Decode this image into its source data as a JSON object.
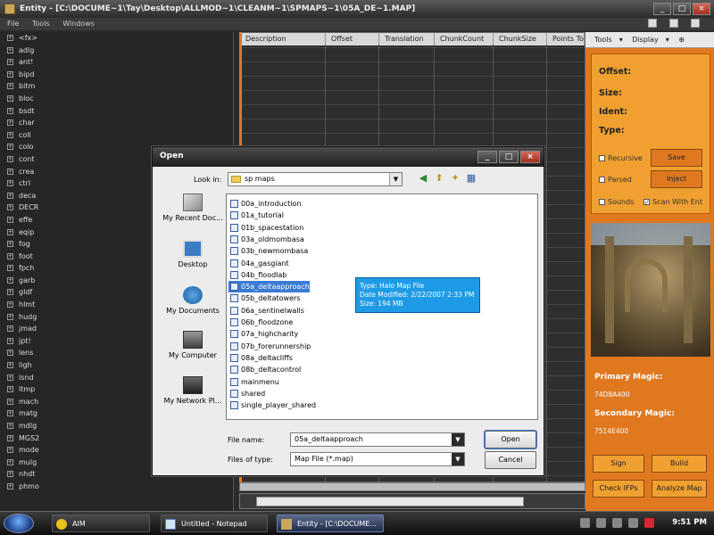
{
  "app": {
    "title": "Entity - [C:\\DOCUME~1\\Tay\\Desktop\\ALLMOD~1\\CLEANM~1\\SPMAPS~1\\05A_DE~1.MAP]",
    "menu": [
      "File",
      "Tools",
      "Windows"
    ]
  },
  "tags": [
    "<fx>",
    "adlg",
    "ant!",
    "bipd",
    "bitm",
    "bloc",
    "bsdt",
    "char",
    "coll",
    "colo",
    "cont",
    "crea",
    "ctrl",
    "deca",
    "DECR",
    "effe",
    "eqip",
    "fog",
    "foot",
    "fpch",
    "garb",
    "gldf",
    "hlmt",
    "hudg",
    "jmad",
    "jpt!",
    "lens",
    "ligh",
    "lsnd",
    "ltmp",
    "mach",
    "matg",
    "mdlg",
    "MGS2",
    "mode",
    "mulg",
    "nhdt",
    "phmo"
  ],
  "grid": {
    "columns": [
      "Description",
      "Offset",
      "Translation",
      "ChunkCount",
      "ChunkSize",
      "Points To"
    ]
  },
  "right_panel": {
    "toolbar": [
      "Tools",
      "Display"
    ],
    "labels": [
      "Offset:",
      "Size:",
      "Ident:",
      "Type:"
    ],
    "checks": [
      {
        "label": "Recursive",
        "checked": false
      },
      {
        "label": "Parsed",
        "checked": false
      },
      {
        "label": "Sounds",
        "checked": false
      },
      {
        "label": "Scan With Ent",
        "checked": true
      }
    ],
    "save_label": "Save",
    "inject_label": "Inject",
    "primary_magic_label": "Primary Magic:",
    "primary_magic_value": "74D8A400",
    "secondary_magic_label": "Secondary Magic:",
    "secondary_magic_value": "7514E400",
    "buttons": [
      "Sign",
      "Build",
      "Check IFPs",
      "Analyze Map"
    ]
  },
  "dialog": {
    "title": "Open",
    "look_in_label": "Look in:",
    "look_in_value": "sp maps",
    "places": [
      "My Recent Doc...",
      "Desktop",
      "My Documents",
      "My Computer",
      "My Network Pl..."
    ],
    "files": [
      "00a_introduction",
      "01a_tutorial",
      "01b_spacestation",
      "03a_oldmombasa",
      "03b_newmombasa",
      "04a_gasgiant",
      "04b_floodlab",
      "05a_deltaapproach",
      "05b_deltatowers",
      "06a_sentinelwalls",
      "06b_floodzone",
      "07a_highcharity",
      "07b_forerunnership",
      "08a_deltacliffs",
      "08b_deltacontrol",
      "mainmenu",
      "shared",
      "single_player_shared"
    ],
    "selected_index": 7,
    "tooltip": {
      "type": "Type: Halo Map File",
      "modified": "Date Modified: 2/22/2007 2:33 PM",
      "size": "Size: 194 MB"
    },
    "file_name_label": "File name:",
    "file_name_value": "05a_deltaapproach",
    "file_type_label": "Files of type:",
    "file_type_value": "Map File (*.map)",
    "open_label": "Open",
    "cancel_label": "Cancel"
  },
  "taskbar": {
    "items": [
      "AIM",
      "Untitled - Notepad",
      "Entity - [C:\\DOCUME..."
    ],
    "active_index": 2,
    "clock": "9:51 PM"
  }
}
